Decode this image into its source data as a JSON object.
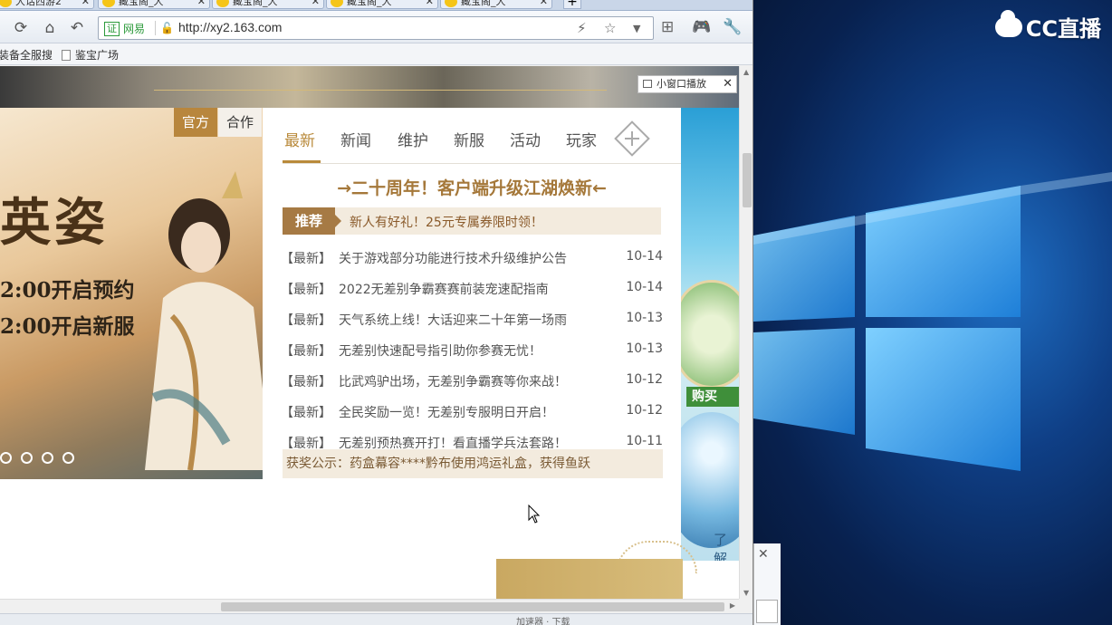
{
  "browser": {
    "tabs": [
      {
        "label": "大话西游2"
      },
      {
        "label": "藏宝阁_大"
      },
      {
        "label": "藏宝阁_大"
      },
      {
        "label": "藏宝阁_大"
      },
      {
        "label": "藏宝阁_大"
      }
    ],
    "new_tab": "+",
    "cert_label": "证",
    "cert_name": "网易",
    "url": "http://xy2.163.com",
    "bookmarks": [
      {
        "label": "装备全服搜"
      },
      {
        "label": "鉴宝广场"
      }
    ],
    "status_text": "加速器 · 下载"
  },
  "page": {
    "mini_player": "小窗口播放",
    "banner": {
      "tab_active": "官方",
      "tab_other": "合作",
      "title": "英姿",
      "line1": "2:00开启预约",
      "line2": "2:00开启新服",
      "slide_count": 4
    },
    "news": {
      "tabs": [
        "最新",
        "新闻",
        "维护",
        "新服",
        "活动",
        "玩家"
      ],
      "headline": "→二十周年！客户端升级江湖焕新←",
      "recommend_tag": "推荐",
      "recommend_text": "新人有好礼！25元专属券限时领！",
      "items": [
        {
          "cat": "【最新】",
          "title": "关于游戏部分功能进行技术升级维护公告",
          "date": "10-14"
        },
        {
          "cat": "【最新】",
          "title": "2022无差别争霸赛赛前装宠速配指南",
          "date": "10-14"
        },
        {
          "cat": "【最新】",
          "title": "天气系统上线！大话迎来二十年第一场雨",
          "date": "10-13"
        },
        {
          "cat": "【最新】",
          "title": "无差别快速配号指引助你参赛无忧！",
          "date": "10-13"
        },
        {
          "cat": "【最新】",
          "title": "比武鸡驴出场，无差别争霸赛等你来战！",
          "date": "10-12"
        },
        {
          "cat": "【最新】",
          "title": "全民奖励一览！无差别专服明日开启！",
          "date": "10-12"
        },
        {
          "cat": "【最新】",
          "title": "无差别预热赛开打！看直播学兵法套路！",
          "date": "10-11"
        }
      ],
      "award": "获奖公示：药盒幕容****黔布使用鸿运礼盒，获得鱼跃"
    },
    "side": {
      "buy_label": "购买",
      "learn_label": "了解"
    }
  },
  "desktop": {
    "stream_logo": "CC直播"
  }
}
